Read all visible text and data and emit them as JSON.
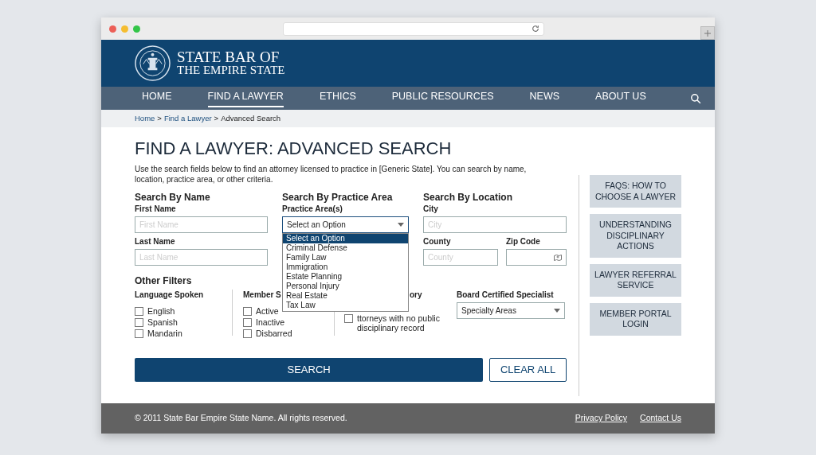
{
  "header": {
    "title_lines": [
      "STATE BAR OF",
      "THE EMPIRE STATE"
    ]
  },
  "nav": {
    "items": [
      {
        "label": "HOME",
        "selected": false
      },
      {
        "label": "FIND A LAWYER",
        "selected": true
      },
      {
        "label": "ETHICS",
        "selected": false
      },
      {
        "label": "PUBLIC RESOURCES",
        "selected": false
      },
      {
        "label": "NEWS",
        "selected": false
      },
      {
        "label": "ABOUT US",
        "selected": false
      }
    ]
  },
  "breadcrumb": {
    "separator": ">",
    "items": [
      {
        "label": "Home",
        "kind": "link"
      },
      {
        "label": "Find a Lawyer",
        "kind": "link"
      },
      {
        "label": "Advanced Search",
        "kind": "current"
      }
    ]
  },
  "page": {
    "title": "FIND A LAWYER: ADVANCED SEARCH",
    "intro": "Use the search fields below to find an attorney licensed to practice in [Generic State]. You can search by name, location, practice area, or other criteria."
  },
  "search_by_name": {
    "heading": "Search By Name",
    "first_label": "First Name",
    "first_placeholder": "First Name",
    "last_label": "Last Name",
    "last_placeholder": "Last Name"
  },
  "search_by_practice": {
    "heading": "Search By Practice Area",
    "label": "Practice Area(s)",
    "value": "Select an Option",
    "expanded": true,
    "options": [
      {
        "label": "Select an Option",
        "selected": true
      },
      {
        "label": "Criminal Defense",
        "selected": false
      },
      {
        "label": "Family Law",
        "selected": false
      },
      {
        "label": "Immigration",
        "selected": false
      },
      {
        "label": "Estate Planning",
        "selected": false
      },
      {
        "label": "Personal Injury",
        "selected": false
      },
      {
        "label": "Real Estate",
        "selected": false
      },
      {
        "label": "Tax Law",
        "selected": false
      }
    ]
  },
  "search_by_location": {
    "heading": "Search By Location",
    "city_label": "City",
    "city_placeholder": "City",
    "county_label": "County",
    "county_placeholder": "County",
    "zip_label": "Zip Code"
  },
  "other_filters": {
    "heading": "Other Filters",
    "language": {
      "heading": "Language Spoken",
      "options": [
        {
          "label": "English",
          "checked": false
        },
        {
          "label": "Spanish",
          "checked": false
        },
        {
          "label": "Mandarin",
          "checked": false
        }
      ]
    },
    "member_status": {
      "heading": "Member S",
      "options": [
        {
          "label": "Active",
          "checked": false
        },
        {
          "label": "Inactive",
          "checked": false
        },
        {
          "label": "Disbarred",
          "checked": false
        }
      ]
    },
    "disciplinary": {
      "heading": "ory",
      "label": "ttorneys with no public disciplinary record",
      "checked": false
    },
    "board": {
      "heading": "Board Certified Specialist",
      "value": "Specialty Areas"
    }
  },
  "actions": {
    "search": "SEARCH",
    "clear": "CLEAR ALL"
  },
  "sidebar": {
    "links": [
      "FAQS: HOW TO CHOOSE A LAWYER",
      "UNDERSTANDING DISCIPLINARY ACTIONS",
      "LAWYER REFERRAL SERVICE",
      "MEMBER PORTAL LOGIN"
    ]
  },
  "footer": {
    "copyright": "© 2011 State Bar Empire State Name. All rights reserved.",
    "links": [
      "Privacy Policy",
      "Contact Us"
    ]
  }
}
